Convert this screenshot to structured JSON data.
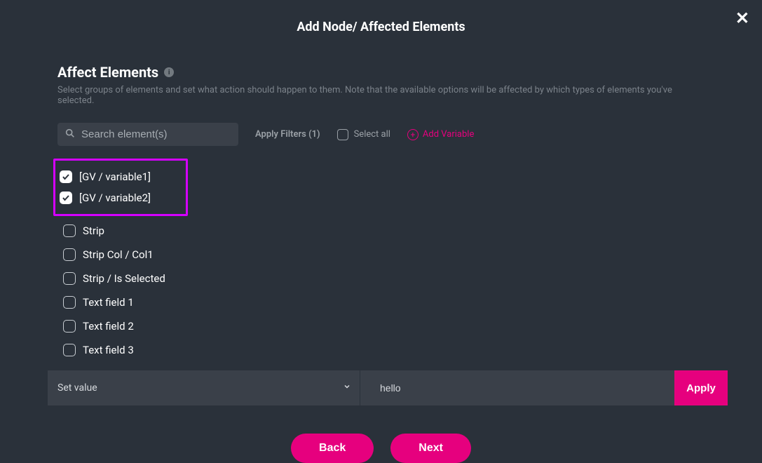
{
  "modal": {
    "title": "Add Node/ Affected Elements",
    "section_title": "Affect Elements",
    "subtext": "Select groups of elements and set what action should happen to them. Note that the available options will be affected by which types of elements you've selected."
  },
  "controls": {
    "search_placeholder": "Search element(s)",
    "filters_label": "Apply Filters (1)",
    "select_all_label": "Select all",
    "add_variable_label": "Add Variable"
  },
  "items": {
    "highlighted": [
      {
        "label": "[GV / variable1]",
        "checked": true
      },
      {
        "label": "[GV / variable2]",
        "checked": true
      }
    ],
    "regular": [
      {
        "label": "Strip",
        "checked": false
      },
      {
        "label": "Strip Col / Col1",
        "checked": false
      },
      {
        "label": "Strip / Is Selected",
        "checked": false
      },
      {
        "label": "Text field 1",
        "checked": false
      },
      {
        "label": "Text field 2",
        "checked": false
      },
      {
        "label": "Text field 3",
        "checked": false
      }
    ]
  },
  "action_row": {
    "action_label": "Set value",
    "value": "hello",
    "apply_label": "Apply"
  },
  "nav": {
    "back": "Back",
    "next": "Next"
  }
}
